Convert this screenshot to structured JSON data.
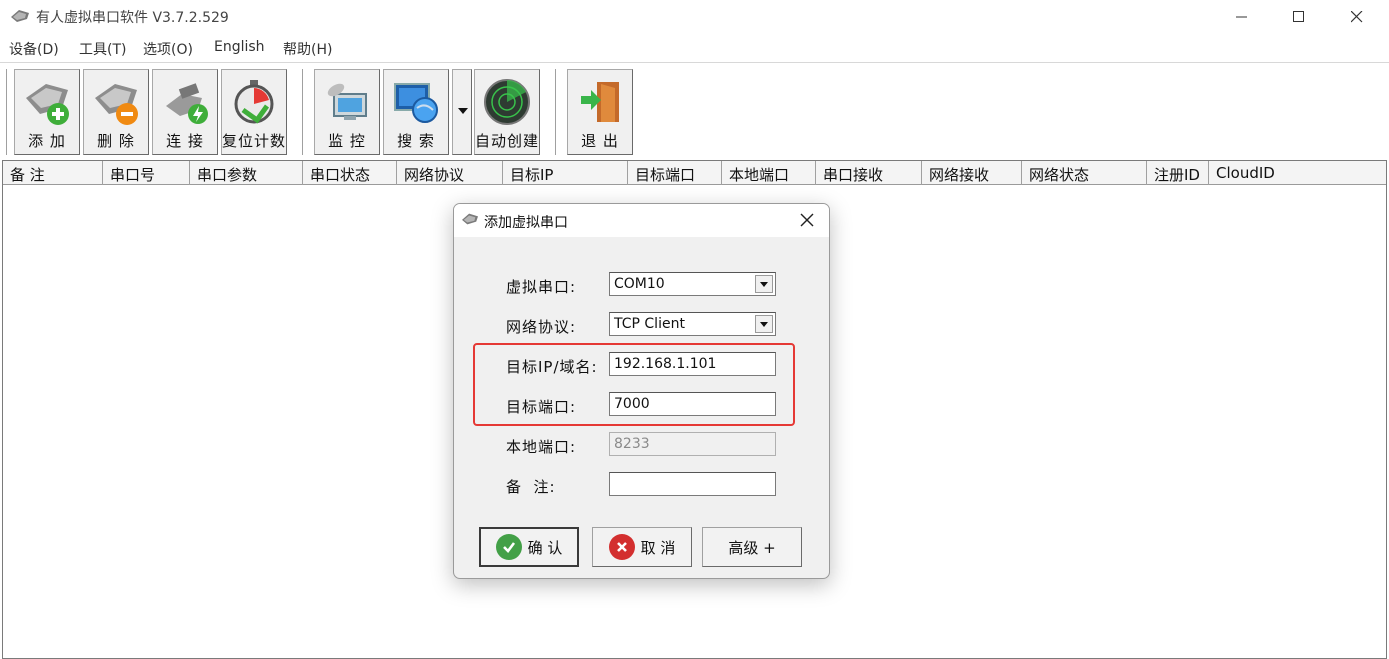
{
  "window": {
    "title": "有人虚拟串口软件 V3.7.2.529"
  },
  "menu": {
    "items": [
      "设备(D)",
      "工具(T)",
      "选项(O)",
      "English",
      "帮助(H)"
    ]
  },
  "toolbar": {
    "add": "添 加",
    "delete": "删 除",
    "connect": "连 接",
    "reset_count": "复位计数",
    "monitor": "监 控",
    "search": "搜 索",
    "auto_create": "自动创建",
    "exit": "退 出"
  },
  "list": {
    "columns": [
      "备 注",
      "串口号",
      "串口参数",
      "串口状态",
      "网络协议",
      "目标IP",
      "目标端口",
      "本地端口",
      "串口接收",
      "网络接收",
      "网络状态",
      "注册ID",
      "CloudID"
    ]
  },
  "dialog": {
    "title": "添加虚拟串口",
    "virtual_port_label": "虚拟串口:",
    "virtual_port_value": "COM10",
    "protocol_label": "网络协议:",
    "protocol_value": "TCP Client",
    "target_ip_label": "目标IP/域名:",
    "target_ip_value": "192.168.1.101",
    "target_port_label": "目标端口:",
    "target_port_value": "7000",
    "local_port_label": "本地端口:",
    "local_port_value": "8233",
    "note_label": "备  注:",
    "note_value": "",
    "ok_label": "确 认",
    "cancel_label": "取 消",
    "advanced_label": "高级 +"
  },
  "colors": {
    "highlight": "#e53935",
    "ok_green": "#43a047",
    "cancel_red": "#d32f2f"
  }
}
